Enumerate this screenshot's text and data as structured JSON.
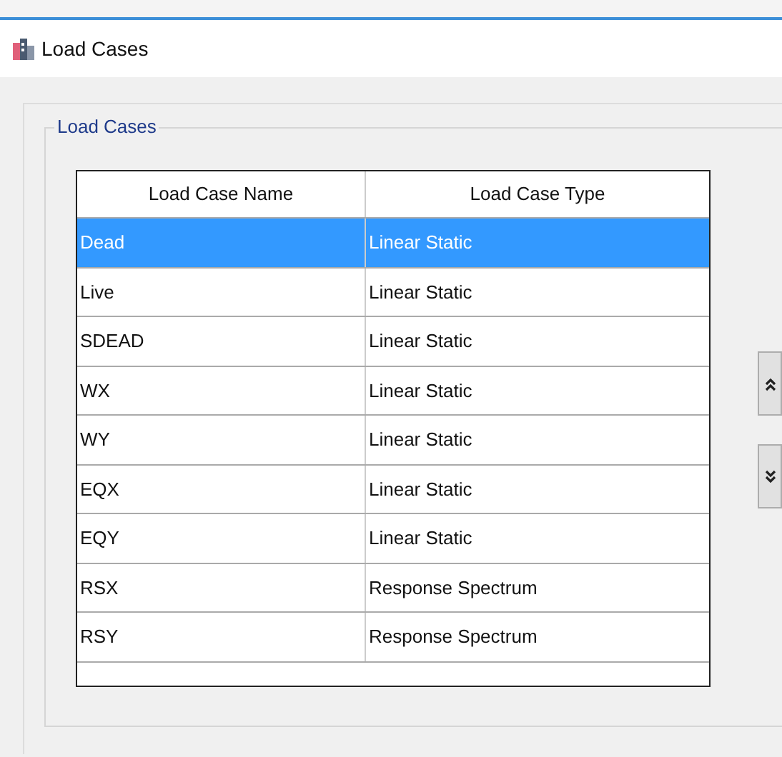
{
  "window": {
    "title": "Load Cases"
  },
  "group": {
    "title": "Load Cases"
  },
  "table": {
    "columns": [
      "Load Case Name",
      "Load Case Type"
    ],
    "rows": [
      {
        "name": "Dead",
        "type": "Linear Static",
        "selected": true
      },
      {
        "name": "Live",
        "type": "Linear Static",
        "selected": false
      },
      {
        "name": "SDEAD",
        "type": "Linear Static",
        "selected": false
      },
      {
        "name": "WX",
        "type": "Linear Static",
        "selected": false
      },
      {
        "name": "WY",
        "type": "Linear Static",
        "selected": false
      },
      {
        "name": "EQX",
        "type": "Linear Static",
        "selected": false
      },
      {
        "name": "EQY",
        "type": "Linear Static",
        "selected": false
      },
      {
        "name": "RSX",
        "type": "Response Spectrum",
        "selected": false
      },
      {
        "name": "RSY",
        "type": "Response Spectrum",
        "selected": false
      }
    ]
  }
}
